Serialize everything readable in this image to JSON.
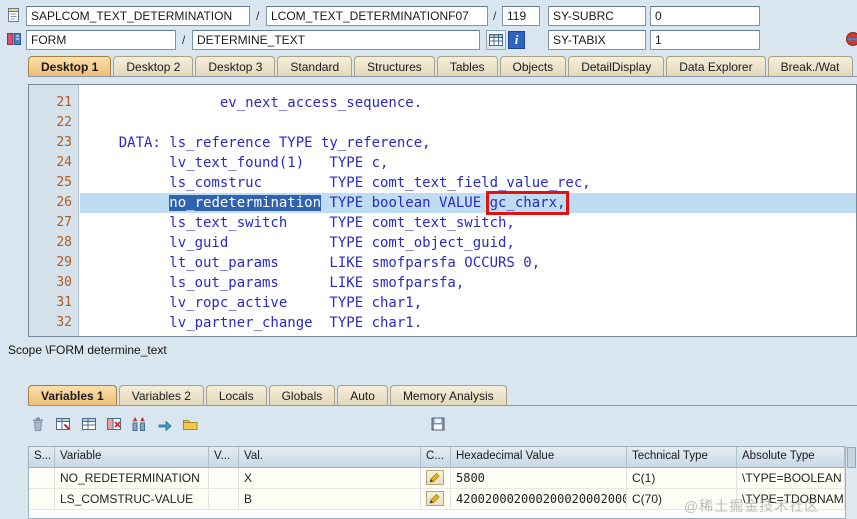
{
  "colors": {
    "code_text": "#2a2ac2",
    "line_number": "#b05c1e",
    "highlight_line_bg": "#bedcf2",
    "selection_bg": "#2f63b0",
    "annotation_box_red": "#e01212",
    "active_tab_bg": "#efbf79"
  },
  "header": {
    "program": "SAPLCOM_TEXT_DETERMINATION",
    "separator": "/",
    "include": "LCOM_TEXT_DETERMINATIONF07",
    "line": "119",
    "sy_subrc_label": "SY-SUBRC",
    "sy_subrc_value": "0",
    "event_type": "FORM",
    "event_name": "DETERMINE_TEXT",
    "sy_tabix_label": "SY-TABIX",
    "sy_tabix_value": "1",
    "info_glyph": "i"
  },
  "desktop_tabs": [
    "Desktop 1",
    "Desktop 2",
    "Desktop 3",
    "Standard",
    "Structures",
    "Tables",
    "Objects",
    "DetailDisplay",
    "Data Explorer",
    "Break./Wat"
  ],
  "code": {
    "lines": [
      {
        "num": "21",
        "text": "                ev_next_access_sequence."
      },
      {
        "num": "22",
        "text": ""
      },
      {
        "num": "23",
        "text": "    DATA: ls_reference TYPE ty_reference,"
      },
      {
        "num": "24",
        "text": "          lv_text_found(1)   TYPE c,"
      },
      {
        "num": "25",
        "text": "          ls_comstruc        TYPE comt_text_field_value_rec,"
      },
      {
        "num": "26",
        "text": ""
      },
      {
        "num": "27",
        "text": "          ls_text_switch     TYPE comt_text_switch,"
      },
      {
        "num": "28",
        "text": "          lv_guid            TYPE comt_object_guid,"
      },
      {
        "num": "29",
        "text": "          lt_out_params      LIKE smofparsfa OCCURS 0,"
      },
      {
        "num": "30",
        "text": "          ls_out_params      LIKE smofparsfa,"
      },
      {
        "num": "31",
        "text": "          lv_ropc_active     TYPE char1,"
      },
      {
        "num": "32",
        "text": "          lv_partner_change  TYPE char1."
      }
    ],
    "line26": {
      "indent": "          ",
      "selected": "no_redetermination",
      "mid": " TYPE boolean VALUE ",
      "boxed": "gc_charx,"
    }
  },
  "scope_text": "Scope \\FORM determine_text",
  "variable_tabs": [
    "Variables 1",
    "Variables 2",
    "Locals",
    "Globals",
    "Auto",
    "Memory Analysis"
  ],
  "variables_table": {
    "headers": [
      "S...",
      "Variable",
      "V...",
      "Val.",
      "C...",
      "Hexadecimal Value",
      "Technical Type",
      "Absolute Type"
    ],
    "rows": [
      {
        "variable": "NO_REDETERMINATION",
        "val": "X",
        "hex": "5800",
        "technical_type": "C(1)",
        "absolute_type": "\\TYPE=BOOLEAN"
      },
      {
        "variable": "LS_COMSTRUC-VALUE",
        "val": "B",
        "hex": "4200200020002000200020002000...",
        "technical_type": "C(70)",
        "absolute_type": "\\TYPE=TDOBNAME"
      }
    ]
  },
  "icons": {
    "header": [
      "document-icon",
      "form-icon",
      "grid-icon",
      "info-icon",
      "status-icon"
    ],
    "toolbar": [
      "trash-icon",
      "table-edit-icon",
      "table-icon",
      "table-delete-icon",
      "sort-columns-icon",
      "forward-arrow-icon",
      "folder-icon",
      "save-disk-icon"
    ],
    "table": [
      "pencil-icon"
    ]
  },
  "watermark": "@稀土掘金技术社区"
}
